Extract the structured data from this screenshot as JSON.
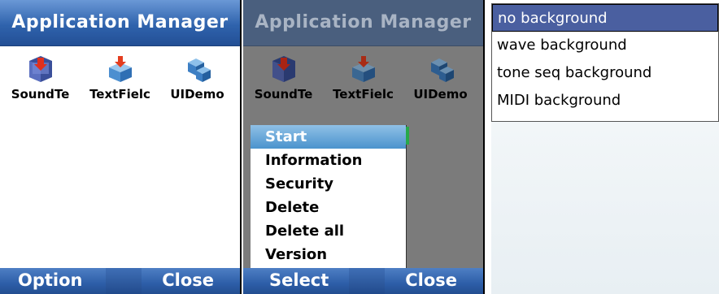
{
  "screen1": {
    "title": "Application Manager",
    "apps": [
      {
        "label": "SoundTe",
        "icon": "sound-test-icon"
      },
      {
        "label": "TextFielc",
        "icon": "text-field-icon"
      },
      {
        "label": "UIDemo",
        "icon": "ui-demo-icon"
      }
    ],
    "softkeys": {
      "left": "Option",
      "right": "Close"
    }
  },
  "screen2": {
    "title": "Application Manager",
    "apps": [
      {
        "label": "SoundTe",
        "icon": "sound-test-icon"
      },
      {
        "label": "TextFielc",
        "icon": "text-field-icon"
      },
      {
        "label": "UIDemo",
        "icon": "ui-demo-icon"
      }
    ],
    "menu": [
      "Start",
      "Information",
      "Security",
      "Delete",
      "Delete all",
      "Version"
    ],
    "selected_menu_index": 0,
    "softkeys": {
      "left": "Select",
      "right": "Close"
    }
  },
  "screen3": {
    "list": [
      "no background",
      "wave background",
      "tone seq background",
      "MIDI background"
    ],
    "selected_index": 0
  },
  "colors": {
    "titlebar": "#2f63ad",
    "selection": "#4b93cd",
    "list_selection": "#4a5fa0"
  }
}
